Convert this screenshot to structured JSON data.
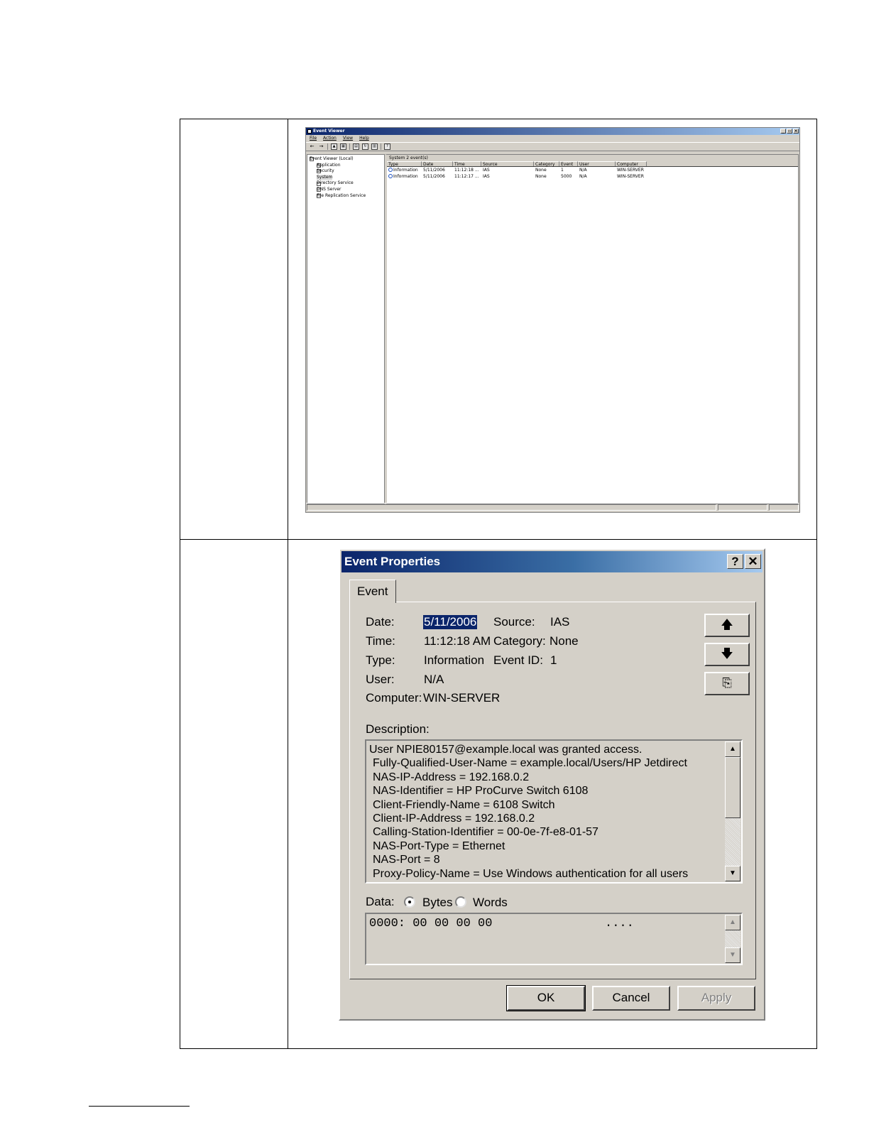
{
  "event_viewer": {
    "title": "Event Viewer",
    "window_controls": [
      "_",
      "▫",
      "×"
    ],
    "menu": [
      "File",
      "Action",
      "View",
      "Help"
    ],
    "toolbar_icons": [
      "back-icon",
      "forward-icon",
      "up-icon",
      "show-tree-icon",
      "properties-icon",
      "refresh-icon",
      "export-icon",
      "help-icon"
    ],
    "tree": {
      "root": "Event Viewer (Local)",
      "items": [
        "Application",
        "Security",
        "System",
        "Directory Service",
        "DNS Server",
        "File Replication Service"
      ],
      "selected": "System"
    },
    "list_caption": "System   2 event(s)",
    "columns": [
      "Type",
      "Date",
      "Time",
      "Source",
      "Category",
      "Event",
      "User",
      "Computer"
    ],
    "rows": [
      [
        "Information",
        "5/11/2006",
        "11:12:18 ...",
        "IAS",
        "None",
        "1",
        "N/A",
        "WIN-SERVER"
      ],
      [
        "Information",
        "5/11/2006",
        "11:12:17 ...",
        "IAS",
        "None",
        "5000",
        "N/A",
        "WIN-SERVER"
      ]
    ]
  },
  "dialog": {
    "title": "Event Properties",
    "help_button": "?",
    "close_button": "✕",
    "tab": "Event",
    "labels": {
      "date": "Date:",
      "time": "Time:",
      "type": "Type:",
      "user": "User:",
      "computer": "Computer:",
      "source": "Source:",
      "category": "Category:",
      "event_id": "Event ID:",
      "description": "Description:",
      "data": "Data:",
      "bytes": "Bytes",
      "words": "Words"
    },
    "values": {
      "date": "5/11/2006",
      "time": "11:12:18 AM",
      "type": "Information",
      "user": "N/A",
      "computer": "WIN-SERVER",
      "source": "IAS",
      "category": "None",
      "event_id": "1"
    },
    "description_lines": [
      "User NPIE80157@example.local was granted access.",
      "Fully-Qualified-User-Name = example.local/Users/HP Jetdirect",
      "NAS-IP-Address = 192.168.0.2",
      "NAS-Identifier = HP ProCurve Switch 6108",
      "Client-Friendly-Name = 6108 Switch",
      "Client-IP-Address = 192.168.0.2",
      "Calling-Station-Identifier = 00-0e-7f-e8-01-57",
      "NAS-Port-Type = Ethernet",
      "NAS-Port = 8",
      "Proxy-Policy-Name = Use Windows authentication for all users"
    ],
    "data_format_selected": "Bytes",
    "data_dump": "0000: 00 00 00 00",
    "data_ascii": "....",
    "buttons": {
      "ok": "OK",
      "cancel": "Cancel",
      "apply": "Apply"
    }
  }
}
